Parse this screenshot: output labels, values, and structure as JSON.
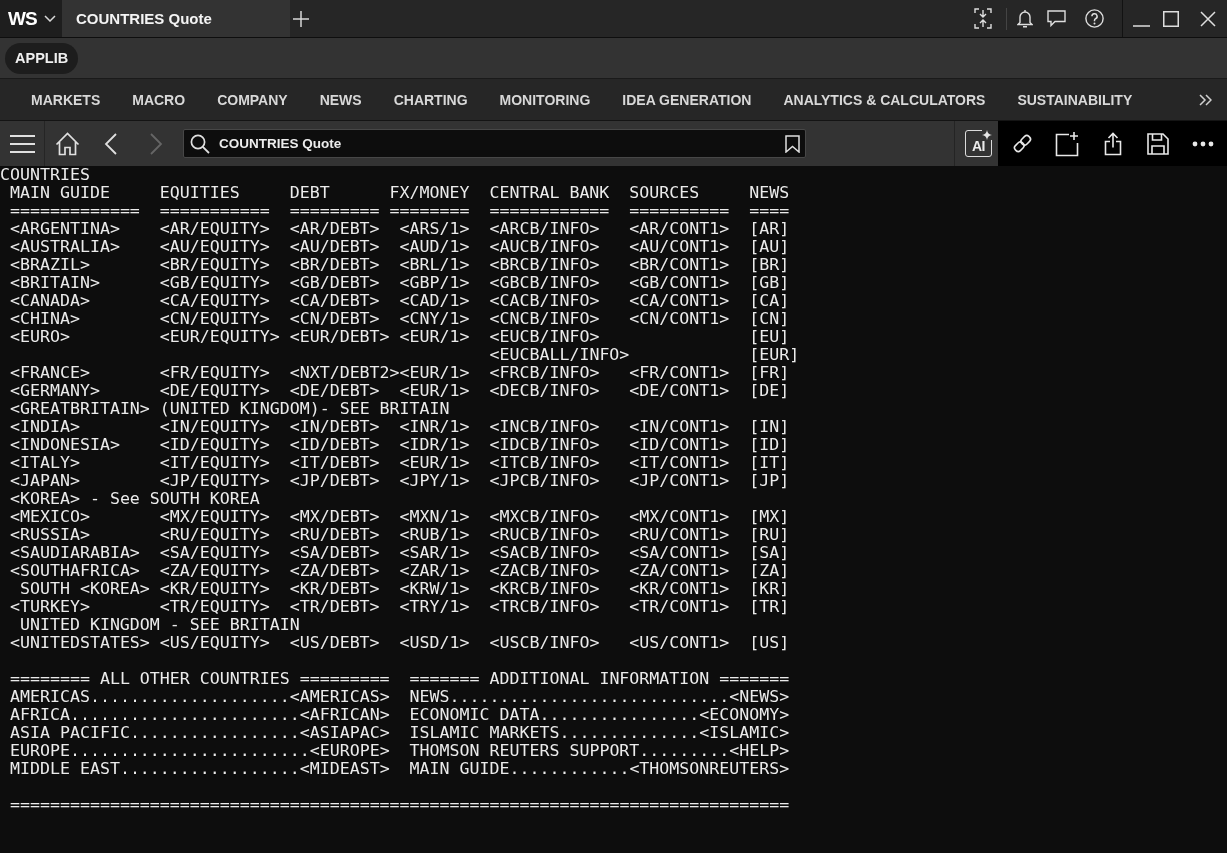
{
  "title_bar": {
    "logo": "WS",
    "tabs": [
      {
        "label": "COUNTRIES Quote",
        "selected": true
      }
    ]
  },
  "app_bar": {
    "chip": "APPLIB"
  },
  "menu": {
    "items": [
      "MARKETS",
      "MACRO",
      "COMPANY",
      "NEWS",
      "CHARTING",
      "MONITORING",
      "IDEA GENERATION",
      "ANALYTICS & CALCULATORS",
      "SUSTAINABILITY"
    ]
  },
  "toolbar": {
    "back": {
      "disabled": false
    },
    "forward": {
      "disabled": true
    },
    "search": {
      "value": "COUNTRIES Quote"
    },
    "assistant": {
      "label": "AI"
    }
  },
  "page": {
    "title": "COUNTRIES",
    "columns": [
      {
        "heading": "MAIN GUIDE",
        "rule": "============="
      },
      {
        "heading": "EQUITIES",
        "rule": "==========="
      },
      {
        "heading": "DEBT",
        "rule": "========="
      },
      {
        "heading": "FX/MONEY",
        "rule": "========"
      },
      {
        "heading": "CENTRAL BANK",
        "rule": "============"
      },
      {
        "heading": "SOURCES",
        "rule": "=========="
      },
      {
        "heading": "NEWS",
        "rule": "===="
      }
    ],
    "rows": [
      {
        "kind": "country",
        "main_guide": "<ARGENTINA>",
        "equities": "<AR/EQUITY>",
        "debt": "<AR/DEBT>",
        "fx_money": "<ARS/1>",
        "central_bank": "<ARCB/INFO>",
        "sources": "<AR/CONT1>",
        "news": "[AR]"
      },
      {
        "kind": "country",
        "main_guide": "<AUSTRALIA>",
        "equities": "<AU/EQUITY>",
        "debt": "<AU/DEBT>",
        "fx_money": "<AUD/1>",
        "central_bank": "<AUCB/INFO>",
        "sources": "<AU/CONT1>",
        "news": "[AU]"
      },
      {
        "kind": "country",
        "main_guide": "<BRAZIL>",
        "equities": "<BR/EQUITY>",
        "debt": "<BR/DEBT>",
        "fx_money": "<BRL/1>",
        "central_bank": "<BRCB/INFO>",
        "sources": "<BR/CONT1>",
        "news": "[BR]"
      },
      {
        "kind": "country",
        "main_guide": "<BRITAIN>",
        "equities": "<GB/EQUITY>",
        "debt": "<GB/DEBT>",
        "fx_money": "<GBP/1>",
        "central_bank": "<GBCB/INFO>",
        "sources": "<GB/CONT1>",
        "news": "[GB]"
      },
      {
        "kind": "country",
        "main_guide": "<CANADA>",
        "equities": "<CA/EQUITY>",
        "debt": "<CA/DEBT>",
        "fx_money": "<CAD/1>",
        "central_bank": "<CACB/INFO>",
        "sources": "<CA/CONT1>",
        "news": "[CA]"
      },
      {
        "kind": "country",
        "main_guide": "<CHINA>",
        "equities": "<CN/EQUITY>",
        "debt": "<CN/DEBT>",
        "fx_money": "<CNY/1>",
        "central_bank": "<CNCB/INFO>",
        "sources": "<CN/CONT1>",
        "news": "[CN]"
      },
      {
        "kind": "country",
        "main_guide": "<EURO>",
        "equities": "<EUR/EQUITY>",
        "debt": "<EUR/DEBT>",
        "fx_money": "<EUR/1>",
        "central_bank": "<EUCB/INFO>",
        "news": "[EU]"
      },
      {
        "kind": "country",
        "central_bank": "<EUCBALL/INFO>",
        "news": "[EUR]"
      },
      {
        "kind": "country",
        "main_guide": "<FRANCE>",
        "equities": "<FR/EQUITY>",
        "debt": "<NXT/DEBT2>",
        "fx_money": "<EUR/1>",
        "central_bank": "<FRCB/INFO>",
        "sources": "<FR/CONT1>",
        "news": "[FR]"
      },
      {
        "kind": "country",
        "main_guide": "<GERMANY>",
        "equities": "<DE/EQUITY>",
        "debt": "<DE/DEBT>",
        "fx_money": "<EUR/1>",
        "central_bank": "<DECB/INFO>",
        "sources": "<DE/CONT1>",
        "news": "[DE]"
      },
      {
        "kind": "redirect",
        "main_guide": "<GREATBRITAIN>",
        "note": "(UNITED KINGDOM)- SEE BRITAIN"
      },
      {
        "kind": "country",
        "main_guide": "<INDIA>",
        "equities": "<IN/EQUITY>",
        "debt": "<IN/DEBT>",
        "fx_money": "<INR/1>",
        "central_bank": "<INCB/INFO>",
        "sources": "<IN/CONT1>",
        "news": "[IN]"
      },
      {
        "kind": "country",
        "main_guide": "<INDONESIA>",
        "equities": "<ID/EQUITY>",
        "debt": "<ID/DEBT>",
        "fx_money": "<IDR/1>",
        "central_bank": "<IDCB/INFO>",
        "sources": "<ID/CONT1>",
        "news": "[ID]"
      },
      {
        "kind": "country",
        "main_guide": "<ITALY>",
        "equities": "<IT/EQUITY>",
        "debt": "<IT/DEBT>",
        "fx_money": "<EUR/1>",
        "central_bank": "<ITCB/INFO>",
        "sources": "<IT/CONT1>",
        "news": "[IT]"
      },
      {
        "kind": "country",
        "main_guide": "<JAPAN>",
        "equities": "<JP/EQUITY>",
        "debt": "<JP/DEBT>",
        "fx_money": "<JPY/1>",
        "central_bank": "<JPCB/INFO>",
        "sources": "<JP/CONT1>",
        "news": "[JP]"
      },
      {
        "kind": "remark",
        "text": "<KOREA> - See SOUTH KOREA"
      },
      {
        "kind": "country",
        "main_guide": "<MEXICO>",
        "equities": "<MX/EQUITY>",
        "debt": "<MX/DEBT>",
        "fx_money": "<MXN/1>",
        "central_bank": "<MXCB/INFO>",
        "sources": "<MX/CONT1>",
        "news": "[MX]"
      },
      {
        "kind": "country",
        "main_guide": "<RUSSIA>",
        "equities": "<RU/EQUITY>",
        "debt": "<RU/DEBT>",
        "fx_money": "<RUB/1>",
        "central_bank": "<RUCB/INFO>",
        "sources": "<RU/CONT1>",
        "news": "[RU]"
      },
      {
        "kind": "country",
        "main_guide": "<SAUDIARABIA>",
        "equities": "<SA/EQUITY>",
        "debt": "<SA/DEBT>",
        "fx_money": "<SAR/1>",
        "central_bank": "<SACB/INFO>",
        "sources": "<SA/CONT1>",
        "news": "[SA]"
      },
      {
        "kind": "country",
        "main_guide": "<SOUTHAFRICA>",
        "equities": "<ZA/EQUITY>",
        "debt": "<ZA/DEBT>",
        "fx_money": "<ZAR/1>",
        "central_bank": "<ZACB/INFO>",
        "sources": "<ZA/CONT1>",
        "news": "[ZA]"
      },
      {
        "kind": "alias",
        "main_guide": "SOUTH <KOREA>",
        "equities": "<KR/EQUITY>",
        "debt": "<KR/DEBT>",
        "fx_money": "<KRW/1>",
        "central_bank": "<KRCB/INFO>",
        "sources": "<KR/CONT1>",
        "news": "[KR]"
      },
      {
        "kind": "country",
        "main_guide": "<TURKEY>",
        "equities": "<TR/EQUITY>",
        "debt": "<TR/DEBT>",
        "fx_money": "<TRY/1>",
        "central_bank": "<TRCB/INFO>",
        "sources": "<TR/CONT1>",
        "news": "[TR]"
      },
      {
        "kind": "alias_remark",
        "text": "UNITED KINGDOM - SEE BRITAIN"
      },
      {
        "kind": "country",
        "main_guide": "<UNITEDSTATES>",
        "equities": "<US/EQUITY>",
        "debt": "<US/DEBT>",
        "fx_money": "<USD/1>",
        "central_bank": "<USCB/INFO>",
        "sources": "<US/CONT1>",
        "news": "[US]"
      }
    ],
    "sections": [
      {
        "title": "======== ALL OTHER COUNTRIES =========",
        "items": [
          {
            "label": "AMERICAS",
            "leader": "....................",
            "code": "<AMERICAS>"
          },
          {
            "label": "AFRICA",
            "leader": ".......................",
            "code": "<AFRICAN>"
          },
          {
            "label": "ASIA PACIFIC",
            "leader": ".................",
            "code": "<ASIAPAC>"
          },
          {
            "label": "EUROPE",
            "leader": "........................",
            "code": "<EUROPE>"
          },
          {
            "label": "MIDDLE EAST",
            "leader": "..................",
            "code": "<MIDEAST>"
          }
        ]
      },
      {
        "title": "======= ADDITIONAL INFORMATION =======",
        "items": [
          {
            "label": "NEWS",
            "leader": "............................",
            "code": "<NEWS>"
          },
          {
            "label": "ECONOMIC DATA",
            "leader": "................",
            "code": "<ECONOMY>"
          },
          {
            "label": "ISLAMIC MARKETS",
            "leader": "..............",
            "code": "<ISLAMIC>"
          },
          {
            "label": "THOMSON REUTERS SUPPORT",
            "leader": ".........",
            "code": "<HELP>"
          },
          {
            "label": "MAIN GUIDE",
            "leader": "............",
            "code": "<THOMSONREUTERS>"
          }
        ]
      }
    ],
    "footer_rule": "=============================================================================="
  }
}
